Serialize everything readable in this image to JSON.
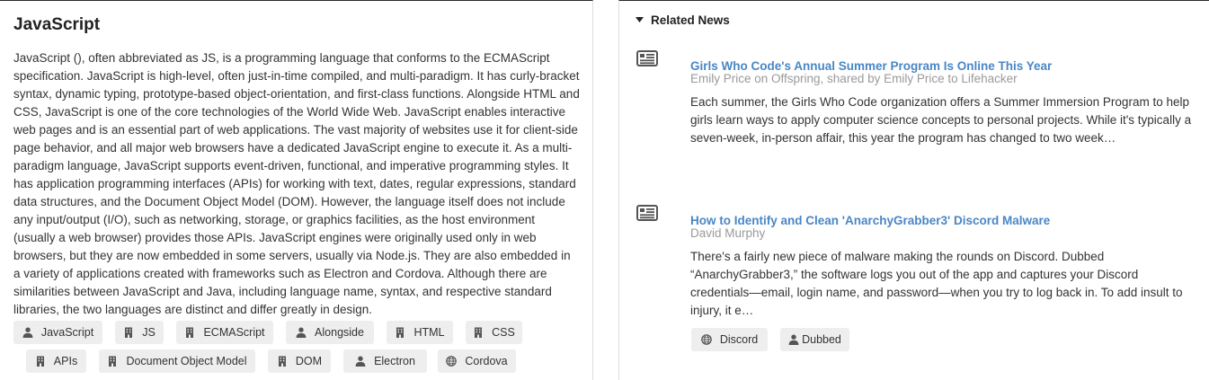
{
  "left": {
    "title": "JavaScript",
    "summary": "JavaScript (), often abbreviated as JS, is a programming language that conforms to the ECMAScript specification. JavaScript is high-level, often just-in-time compiled, and multi-paradigm. It has curly-bracket syntax, dynamic typing, prototype-based object-orientation, and first-class functions. Alongside HTML and CSS, JavaScript is one of the core technologies of the World Wide Web. JavaScript enables interactive web pages and is an essential part of web applications. The vast majority of websites use it for client-side page behavior, and all major web browsers have a dedicated JavaScript engine to execute it. As a multi-paradigm language, JavaScript supports event-driven, functional, and imperative programming styles. It has application programming interfaces (APIs) for working with text, dates, regular expressions, standard data structures, and the Document Object Model (DOM). However, the language itself does not include any input/output (I/O), such as networking, storage, or graphics facilities, as the host environment (usually a web browser) provides those APIs. JavaScript engines were originally used only in web browsers, but they are now embedded in some servers, usually via Node.js. They are also embedded in a variety of applications created with frameworks such as Electron and Cordova. Although there are similarities between JavaScript and Java, including language name, syntax, and respective standard libraries, the two languages are distinct and differ greatly in design.",
    "tags": [
      {
        "label": "JavaScript",
        "icon": "person-icon"
      },
      {
        "label": "JS",
        "icon": "building-icon"
      },
      {
        "label": "ECMAScript",
        "icon": "building-icon"
      },
      {
        "label": "Alongside",
        "icon": "person-icon"
      },
      {
        "label": "HTML",
        "icon": "building-icon"
      },
      {
        "label": "CSS",
        "icon": "building-icon"
      },
      {
        "label": "APIs",
        "icon": "building-icon"
      },
      {
        "label": "Document Object Model",
        "icon": "building-icon"
      },
      {
        "label": "DOM",
        "icon": "building-icon"
      },
      {
        "label": "Electron",
        "icon": "person-icon"
      },
      {
        "label": "Cordova",
        "icon": "globe-icon"
      }
    ]
  },
  "right": {
    "header": "Related News",
    "header_icon": "caret-down-icon",
    "news": [
      {
        "icon": "newspaper-icon",
        "title": "Girls Who Code's Annual Summer Program Is Online This Year",
        "byline": "Emily Price on Offspring, shared by Emily Price to Lifehacker",
        "body": "Each summer, the Girls Who Code organization offers a Summer Immersion Program to help girls learn ways to apply computer science concepts to personal projects. While it's typically a seven-week, in-person affair, this year the program has changed to two week…",
        "tags": []
      },
      {
        "icon": "newspaper-icon",
        "title": "How to Identify and Clean 'AnarchyGrabber3' Discord Malware",
        "byline": "David Murphy",
        "body": "There's a fairly new piece of malware making the rounds on Discord. Dubbed “AnarchyGrabber3,” the software logs you out of the app and captures your Discord credentials—email, login name, and password—when you try to log back in. To add insult to injury, it e…",
        "tags": [
          {
            "label": "Discord",
            "icon": "globe-icon"
          },
          {
            "label": "Dubbed",
            "icon": "person-icon"
          }
        ]
      }
    ]
  },
  "colors": {
    "link": "#4a86c5",
    "byline": "#9a9a9a",
    "tag_bg": "#eeeeee",
    "icon": "#555555"
  }
}
